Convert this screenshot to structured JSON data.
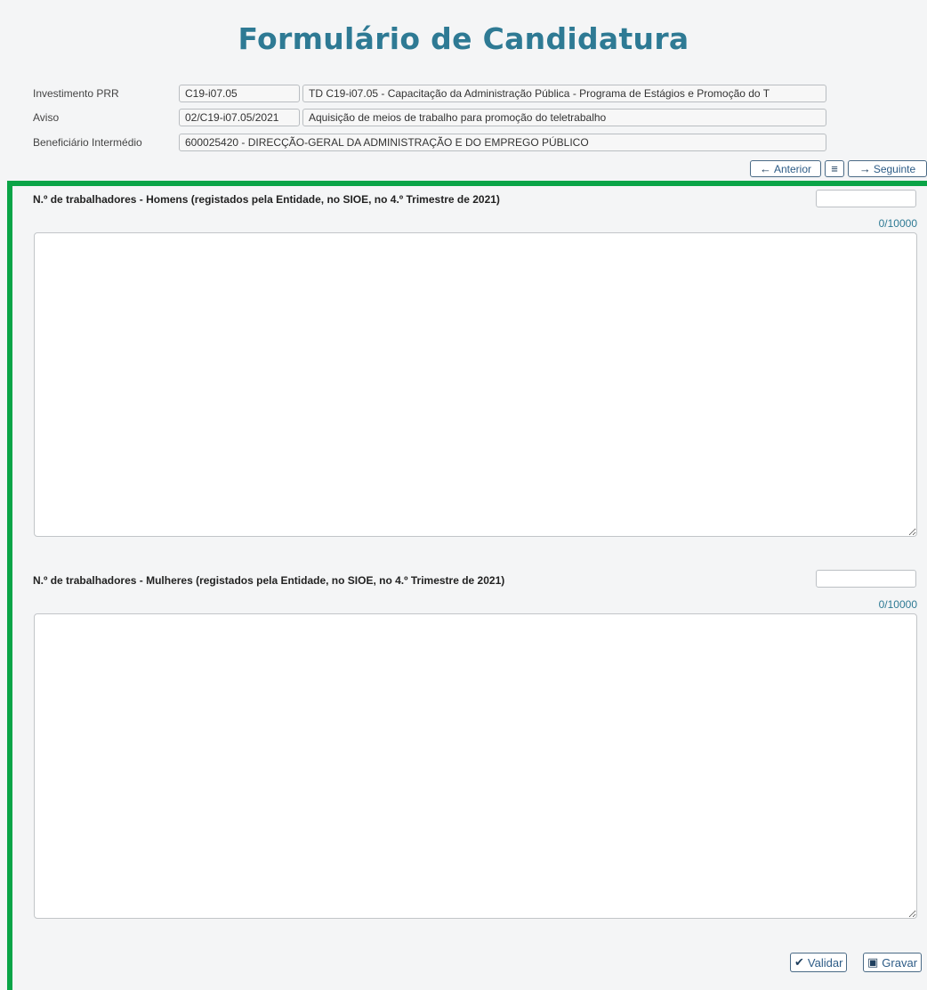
{
  "header": {
    "title": "Formulário de Candidatura"
  },
  "info": {
    "investimento": {
      "label": "Investimento PRR",
      "code": "C19-i07.05",
      "description": "TD C19-i07.05 - Capacitação da Administração Pública - Programa de Estágios e Promoção do T"
    },
    "aviso": {
      "label": "Aviso",
      "code": "02/C19-i07.05/2021",
      "description": "Aquisição de meios de trabalho para promoção do teletrabalho"
    },
    "beneficiario": {
      "label": "Beneficiário Intermédio",
      "value": "600025420 - DIRECÇÃO-GERAL DA ADMINISTRAÇÃO E DO EMPREGO PÚBLICO"
    }
  },
  "navigation": {
    "previous_label": "Anterior",
    "next_label": "Seguinte",
    "previous_icon": "arrow-left-icon",
    "menu_icon": "list-icon",
    "next_icon": "arrow-right-icon"
  },
  "questions": [
    {
      "label": "N.º de trabalhadores - Homens (registados pela Entidade, no SIOE, no 4.º Trimestre de 2021)",
      "value": "",
      "counter": "0/10000",
      "text": ""
    },
    {
      "label": "N.º de trabalhadores - Mulheres (registados pela Entidade, no SIOE, no 4.º Trimestre de 2021)",
      "value": "",
      "counter": "0/10000",
      "text": ""
    }
  ],
  "actions": {
    "validate_label": "Validar",
    "save_label": "Gravar",
    "validate_icon": "checkmark-icon",
    "save_icon": "floppy-disk-icon"
  },
  "colors": {
    "title": "#2e7a94",
    "highlight_frame": "#0aa447",
    "counter": "#2e7a94",
    "button_text": "#2c5b86"
  }
}
